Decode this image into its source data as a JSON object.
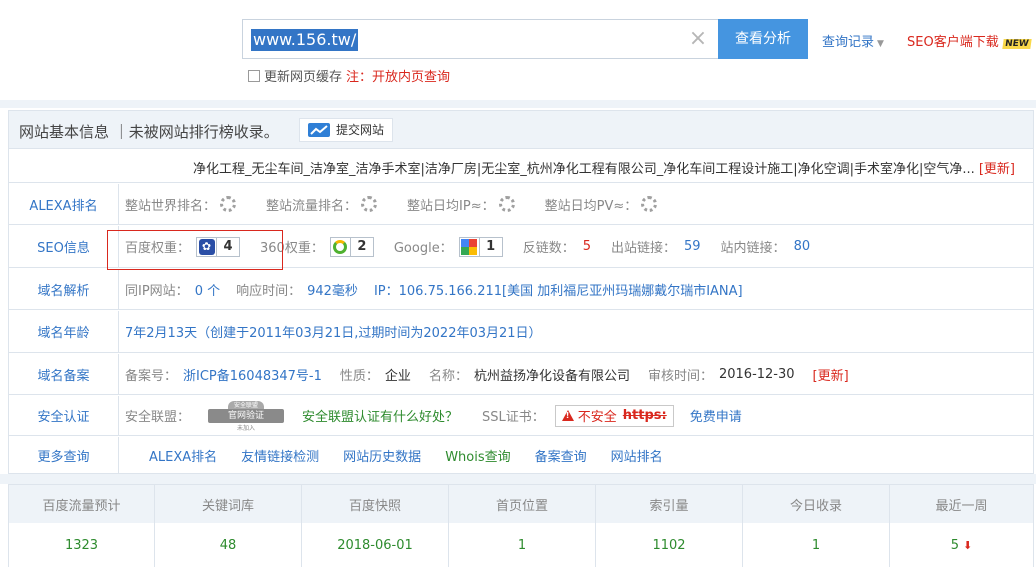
{
  "search": {
    "value": "www.156.tw/",
    "button_label": "查看分析",
    "history_label": "查询记录",
    "seo_client_label": "SEO客户端下载",
    "new_badge": "NEW",
    "cache_label": "更新网页缓存",
    "note_prefix": "注：",
    "note_text": "开放内页查询"
  },
  "panel": {
    "title": "网站基本信息 ｜未被网站排行榜收录。",
    "submit_label": "提交网站",
    "description": "净化工程_无尘车间_洁净室_洁净手术室|洁净厂房|无尘室_杭州净化工程有限公司_净化车间工程设计施工|净化空调|手术室净化|空气净...",
    "update_label": "[更新]"
  },
  "alexa": {
    "label": "ALEXA排名",
    "world_rank": "整站世界排名：",
    "traffic_rank": "整站流量排名：",
    "daily_ip": "整站日均IP≈：",
    "daily_pv": "整站日均PV≈："
  },
  "seo": {
    "label": "SEO信息",
    "baidu_label": "百度权重：",
    "baidu_value": "4",
    "s360_label": "360权重：",
    "s360_value": "2",
    "google_label": "Google：",
    "google_value": "1",
    "backlinks_label": "反链数：",
    "backlinks_value": "5",
    "outbound_label": "出站链接：",
    "outbound_value": "59",
    "inbound_label": "站内链接：",
    "inbound_value": "80"
  },
  "dns": {
    "label": "域名解析",
    "same_ip_label": "同IP网站：",
    "same_ip_value": "0 个",
    "response_label": "响应时间：",
    "response_value": "942毫秒",
    "ip_label": "IP：",
    "ip_value": "106.75.166.211[美国 加利福尼亚州玛瑞娜戴尔瑞市IANA]"
  },
  "age": {
    "label": "域名年龄",
    "value": "7年2月13天（创建于2011年03月21日,过期时间为2022年03月21日）"
  },
  "icp": {
    "label": "域名备案",
    "number_label": "备案号：",
    "number_value": "浙ICP备16048347号-1",
    "nature_label": "性质：",
    "nature_value": "企业",
    "name_label": "名称：",
    "name_value": "杭州益扬净化设备有限公司",
    "audit_label": "审核时间：",
    "audit_value": "2016-12-30",
    "update_label": "[更新]"
  },
  "security": {
    "label": "安全认证",
    "alliance_label": "安全联盟：",
    "seal_top": "安全联盟",
    "seal_text": "官网验证",
    "seal_bottom": "未加入",
    "alliance_link": "安全联盟认证有什么好处？",
    "ssl_label": "SSL证书：",
    "ssl_badge_text": "不安全",
    "ssl_https": "https:",
    "ssl_link": "免费申请"
  },
  "more": {
    "label": "更多查询",
    "links": [
      "ALEXA排名",
      "友情链接检测",
      "网站历史数据",
      "Whois查询",
      "备案查询",
      "网站排名"
    ]
  },
  "stats": {
    "headers": [
      "百度流量预计",
      "关键词库",
      "百度快照",
      "首页位置",
      "索引量",
      "今日收录",
      "最近一周"
    ],
    "values": [
      "1323",
      "48",
      "2018-06-01",
      "1",
      "1102",
      "1",
      "5"
    ]
  },
  "colors": {
    "link_blue": "#3375c6",
    "accent_red": "#d9281e",
    "value_green": "#2e8b2e",
    "button_blue": "#4595e0"
  }
}
